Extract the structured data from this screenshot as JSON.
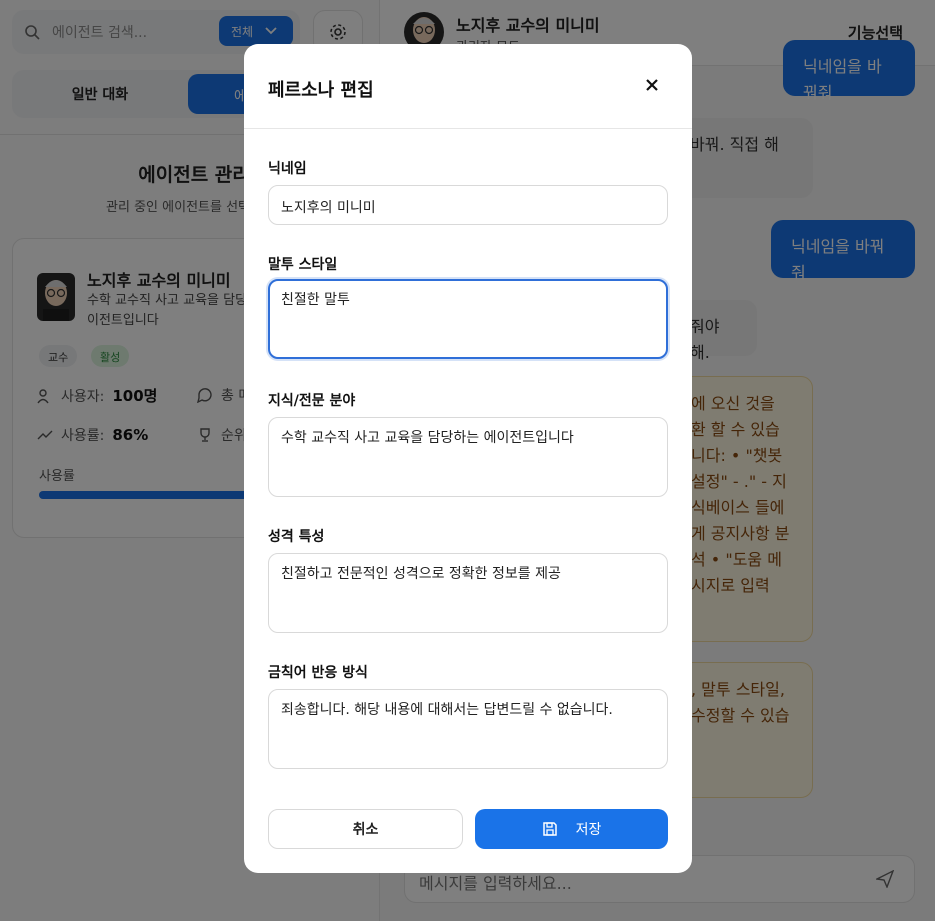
{
  "colors": {
    "accent": "#1a73e8",
    "overlay": "rgba(0,0,0,0.5)",
    "active_badge": "#2b8a3e",
    "warning_bg": "#fff8e3"
  },
  "sidebar": {
    "search_placeholder": "에이전트 검색...",
    "filter_label": "전체",
    "tabs": {
      "general": "일반 대화",
      "agent": "에"
    },
    "management_title": "에이전트 관리",
    "management_subtitle": "관리 중인 에이전트를 선택하여",
    "card": {
      "name": "노지후 교수의 미니미",
      "description": "수학 교수직 사고 교육을 담당 이전트입니다",
      "badges": [
        "교수",
        "활성"
      ],
      "users_label": "사용자:",
      "users_value": "100명",
      "total_label": "총 메",
      "rate_label": "사용률:",
      "rate_value": "86%",
      "rank_label": "순위",
      "usage_label": "사용률",
      "usage_fraction": 0.86
    }
  },
  "chat": {
    "title": "노지후 교수의 미니미",
    "subtitle": "관리자 모드",
    "feature_button": "기능선택",
    "messages": [
      {
        "role": "user",
        "text": "닉네임을 바꿔줘"
      },
      {
        "role": "bot",
        "text": "바꿔. 직접 해"
      },
      {
        "role": "user",
        "text": "닉네임을 바꿔줘"
      },
      {
        "role": "bot",
        "text": "줘야 해."
      },
      {
        "role": "notice",
        "text": "에 오신 것을 환 할 수 있습니다: • \"챗봇 설정\" - .\" - 지식베이스 들에게 공지사항 분석 • \"도움 메시지로 입력"
      },
      {
        "role": "notice",
        "text": ", 말투 스타일, 수정할 수 있습"
      }
    ],
    "input_placeholder": "메시지를 입력하세요..."
  },
  "modal": {
    "title": "페르소나 편집",
    "fields": {
      "nickname": {
        "label": "닉네임",
        "value": "노지후의 미니미"
      },
      "tone": {
        "label": "말투 스타일",
        "value": "친절한 말투"
      },
      "knowledge": {
        "label": "지식/전문 분야",
        "value": "수학 교수직 사고 교육을 담당하는 에이전트입니다"
      },
      "personality": {
        "label": "성격 특성",
        "value": "친절하고 전문적인 성격으로 정확한 정보를 제공"
      },
      "banned": {
        "label": "금칙어 반응 방식",
        "value": "죄송합니다. 해당 내용에 대해서는 답변드릴 수 없습니다."
      }
    },
    "cancel_label": "취소",
    "save_label": "저장"
  }
}
